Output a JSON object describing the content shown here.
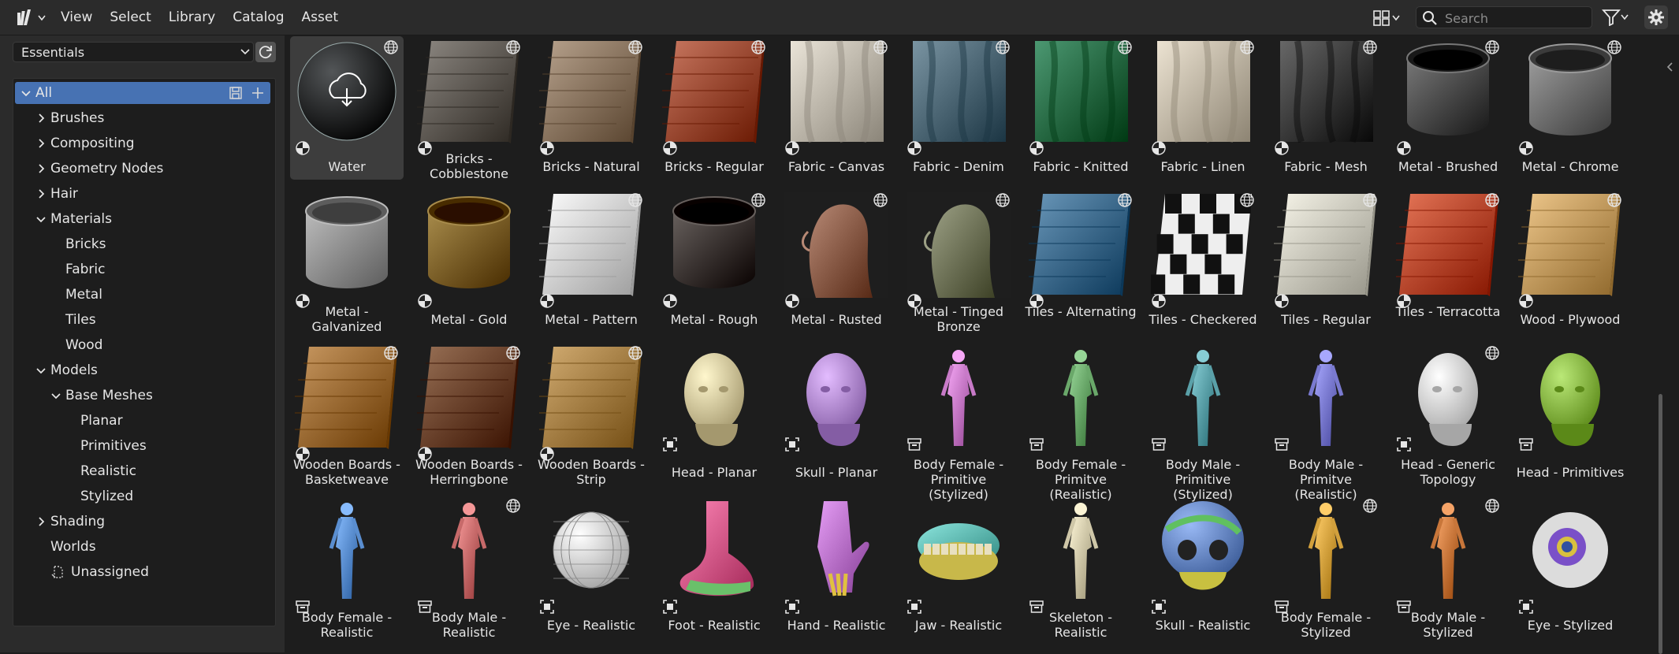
{
  "menu": [
    "View",
    "Select",
    "Library",
    "Catalog",
    "Asset"
  ],
  "search": {
    "placeholder": "Search"
  },
  "library": {
    "selected": "Essentials"
  },
  "tree": [
    {
      "label": "All",
      "level": 0,
      "chev": "down",
      "selected": true
    },
    {
      "label": "Brushes",
      "level": 1,
      "chev": "right"
    },
    {
      "label": "Compositing",
      "level": 1,
      "chev": "right"
    },
    {
      "label": "Geometry Nodes",
      "level": 1,
      "chev": "right"
    },
    {
      "label": "Hair",
      "level": 1,
      "chev": "right"
    },
    {
      "label": "Materials",
      "level": 1,
      "chev": "down"
    },
    {
      "label": "Bricks",
      "level": 2,
      "chev": ""
    },
    {
      "label": "Fabric",
      "level": 2,
      "chev": ""
    },
    {
      "label": "Metal",
      "level": 2,
      "chev": ""
    },
    {
      "label": "Tiles",
      "level": 2,
      "chev": ""
    },
    {
      "label": "Wood",
      "level": 2,
      "chev": ""
    },
    {
      "label": "Models",
      "level": 1,
      "chev": "down"
    },
    {
      "label": "Base Meshes",
      "level": 2,
      "chev": "down"
    },
    {
      "label": "Planar",
      "level": 3,
      "chev": ""
    },
    {
      "label": "Primitives",
      "level": 3,
      "chev": ""
    },
    {
      "label": "Realistic",
      "level": 3,
      "chev": ""
    },
    {
      "label": "Stylized",
      "level": 3,
      "chev": ""
    },
    {
      "label": "Shading",
      "level": 1,
      "chev": "right"
    },
    {
      "label": "Worlds",
      "level": 1,
      "chev": ""
    },
    {
      "label": "Unassigned",
      "level": 1,
      "chev": "",
      "icon": "unassigned-icon"
    }
  ],
  "assets": [
    {
      "name": "Water",
      "kind": "sphere",
      "color": "#26292b",
      "globe": true,
      "badge": "material",
      "active": true
    },
    {
      "name": "Bricks - Cobblestone",
      "kind": "plane",
      "color": "#5f5a54",
      "globe": true,
      "badge": "material"
    },
    {
      "name": "Bricks - Natural",
      "kind": "plane",
      "color": "#8a7560",
      "globe": true,
      "badge": "material"
    },
    {
      "name": "Bricks - Regular",
      "kind": "plane",
      "color": "#9b4a33",
      "globe": true,
      "badge": "material"
    },
    {
      "name": "Fabric - Canvas",
      "kind": "cloth",
      "color": "#bdb7ab",
      "globe": true,
      "badge": "material"
    },
    {
      "name": "Fabric - Denim",
      "kind": "cloth",
      "color": "#4d6775",
      "globe": true,
      "badge": "material"
    },
    {
      "name": "Fabric - Knitted",
      "kind": "cloth",
      "color": "#1f6b45",
      "globe": true,
      "badge": "material"
    },
    {
      "name": "Fabric - Linen",
      "kind": "cloth",
      "color": "#bfb6a5",
      "globe": true,
      "badge": "material"
    },
    {
      "name": "Fabric - Mesh",
      "kind": "cloth",
      "color": "#3a3a3a",
      "globe": true,
      "badge": "material"
    },
    {
      "name": "Metal - Brushed",
      "kind": "cup",
      "color": "#4a4a4a",
      "globe": true,
      "badge": "material"
    },
    {
      "name": "Metal - Chrome",
      "kind": "cup",
      "color": "#6d6d6d",
      "globe": true,
      "badge": "material"
    },
    {
      "name": "Metal - Galvanized",
      "kind": "cup",
      "color": "#8e8e8e",
      "globe": false,
      "badge": "material"
    },
    {
      "name": "Metal - Gold",
      "kind": "cup",
      "color": "#7a5e1e",
      "globe": false,
      "badge": "material"
    },
    {
      "name": "Metal - Pattern",
      "kind": "plane",
      "color": "#cfcfcf",
      "globe": true,
      "badge": "material"
    },
    {
      "name": "Metal - Rough",
      "kind": "cup",
      "color": "#3a3330",
      "globe": true,
      "badge": "material"
    },
    {
      "name": "Metal - Rusted",
      "kind": "head",
      "color": "#8a5c48",
      "globe": true,
      "badge": "material"
    },
    {
      "name": "Metal - Tinged Bronze",
      "kind": "head",
      "color": "#6f7358",
      "globe": true,
      "badge": "material"
    },
    {
      "name": "Tiles - Alternating",
      "kind": "plane",
      "color": "#3d6a8c",
      "globe": true,
      "badge": "material"
    },
    {
      "name": "Tiles - Checkered",
      "kind": "checker",
      "color": "#e8e8e8",
      "globe": true,
      "badge": "material"
    },
    {
      "name": "Tiles - Regular",
      "kind": "plane",
      "color": "#c9c7bb",
      "globe": true,
      "badge": "material"
    },
    {
      "name": "Tiles - Terracotta",
      "kind": "plane",
      "color": "#b8482a",
      "globe": true,
      "badge": "material"
    },
    {
      "name": "Wood - Plywood",
      "kind": "plane",
      "color": "#c19a5e",
      "globe": true,
      "badge": "material"
    },
    {
      "name": "Wooden Boards - Basketweave",
      "kind": "plane",
      "color": "#9a6a33",
      "globe": true,
      "badge": "material"
    },
    {
      "name": "Wooden Boards - Herringbone",
      "kind": "plane",
      "color": "#6b4328",
      "globe": true,
      "badge": "material"
    },
    {
      "name": "Wooden Boards - Strip",
      "kind": "plane",
      "color": "#a57f45",
      "globe": true,
      "badge": "material"
    },
    {
      "name": "Head - Planar",
      "kind": "bust",
      "color": "#d6caa0",
      "globe": false,
      "badge": "object"
    },
    {
      "name": "Skull - Planar",
      "kind": "bust",
      "color": "#b68fd6",
      "globe": false,
      "badge": "object"
    },
    {
      "name": "Body Female - Primitive (Stylized)",
      "kind": "body",
      "color": "#c87ac8",
      "globe": false,
      "badge": "collection"
    },
    {
      "name": "Body Female - Primitve (Realistic)",
      "kind": "body",
      "color": "#6aa86a",
      "globe": false,
      "badge": "collection"
    },
    {
      "name": "Body Male - Primitive (Stylized)",
      "kind": "body",
      "color": "#5aa0a8",
      "globe": false,
      "badge": "collection"
    },
    {
      "name": "Body Male - Primitve (Realistic)",
      "kind": "body",
      "color": "#7a7ad0",
      "globe": false,
      "badge": "collection"
    },
    {
      "name": "Head - Generic Topology",
      "kind": "bust",
      "color": "#d8d8d8",
      "globe": true,
      "badge": "object"
    },
    {
      "name": "Head - Primitives",
      "kind": "bust",
      "color": "#8dbb4a",
      "globe": false,
      "badge": "collection"
    },
    {
      "name": "Body Female - Realistic",
      "kind": "body",
      "color": "#5a8ed0",
      "globe": false,
      "badge": "collection"
    },
    {
      "name": "Body Male - Realistic",
      "kind": "body",
      "color": "#c76a6a",
      "globe": true,
      "badge": "collection"
    },
    {
      "name": "Eye - Realistic",
      "kind": "ball",
      "color": "#d2d2d2",
      "globe": false,
      "badge": "object"
    },
    {
      "name": "Foot - Realistic",
      "kind": "foot",
      "color": "#d65a8a",
      "globe": false,
      "badge": "object"
    },
    {
      "name": "Hand - Realistic",
      "kind": "hand",
      "color": "#b870c8",
      "globe": false,
      "badge": "object"
    },
    {
      "name": "Jaw - Realistic",
      "kind": "jaw",
      "color": "#5fb8b0",
      "globe": false,
      "badge": "object"
    },
    {
      "name": "Skeleton - Realistic",
      "kind": "body",
      "color": "#cfc7a8",
      "globe": false,
      "badge": "collection"
    },
    {
      "name": "Skull - Realistic",
      "kind": "skull",
      "color": "#6c8cc8",
      "globe": false,
      "badge": "object"
    },
    {
      "name": "Body Female - Stylized",
      "kind": "body",
      "color": "#d2a03c",
      "globe": true,
      "badge": "collection"
    },
    {
      "name": "Body Male - Stylized",
      "kind": "body",
      "color": "#c8763a",
      "globe": true,
      "badge": "collection"
    },
    {
      "name": "Eye - Stylized",
      "kind": "eye",
      "color": "#7a50c8",
      "globe": false,
      "badge": "object"
    }
  ]
}
